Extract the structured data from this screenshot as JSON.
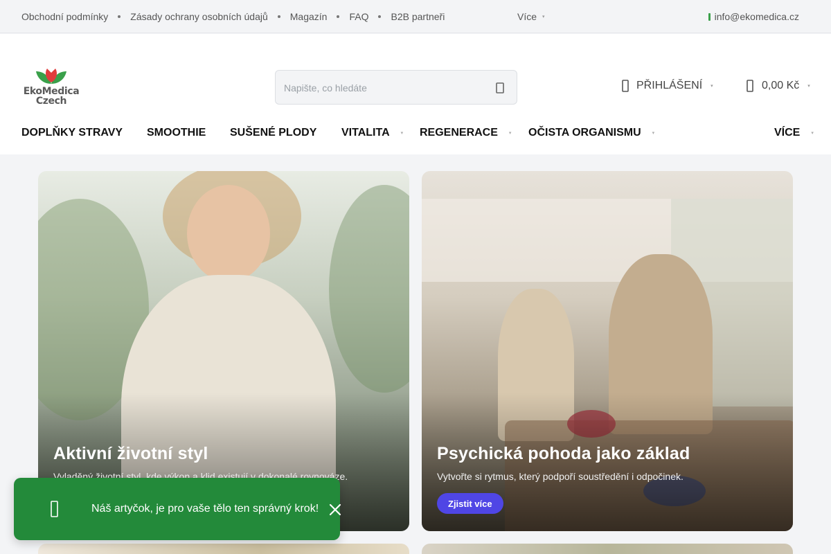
{
  "topbar": {
    "links": [
      {
        "label": "Obchodní podmínky"
      },
      {
        "label": "Zásady ochrany osobních údajů"
      },
      {
        "label": "Magazín"
      },
      {
        "label": "FAQ"
      },
      {
        "label": "B2B partneři"
      }
    ],
    "more_label": "Více",
    "email": "info@ekomedica.cz",
    "icons": {
      "caret": "caret-down-icon",
      "mail": "envelope-icon"
    }
  },
  "header": {
    "logo_line1": "EkoMedica",
    "logo_line2": "Czech",
    "search_placeholder": "Napište, co hledáte",
    "login_label": "PŘIHLÁŠENÍ",
    "cart_total": "0,00 Kč",
    "icons": {
      "search": "search-icon",
      "user": "user-icon",
      "cart": "shopping-bag-icon"
    }
  },
  "nav": {
    "items": [
      {
        "label": "DOPLŇKY STRAVY",
        "has_dropdown": false
      },
      {
        "label": "SMOOTHIE",
        "has_dropdown": false
      },
      {
        "label": "SUŠENÉ PLODY",
        "has_dropdown": false
      },
      {
        "label": "VITALITA",
        "has_dropdown": true
      },
      {
        "label": "REGENERACE",
        "has_dropdown": true
      },
      {
        "label": "OČISTA ORGANISMU",
        "has_dropdown": true
      }
    ],
    "more_label": "VÍCE"
  },
  "cards": [
    {
      "title": "Aktivní životní styl",
      "description": "Vyladěný životní styl, kde výkon a klid existují v dokonalé rovnováze."
    },
    {
      "title": "Psychická pohoda jako základ",
      "description": "Vytvořte si rytmus, který podpoří soustředění i odpočinek.",
      "cta": "Zjistit více"
    }
  ],
  "toast": {
    "message": "Náš artyčok, je pro vaše tělo ten správný krok!",
    "icons": {
      "leaf": "leaf-icon",
      "close": "close-icon"
    }
  },
  "colors": {
    "brand_green": "#238a3a",
    "logo_red": "#e03c3c",
    "logo_green": "#3aa04a",
    "cta_purple": "#4f46e5",
    "topbar_bg": "#f3f4f6"
  }
}
